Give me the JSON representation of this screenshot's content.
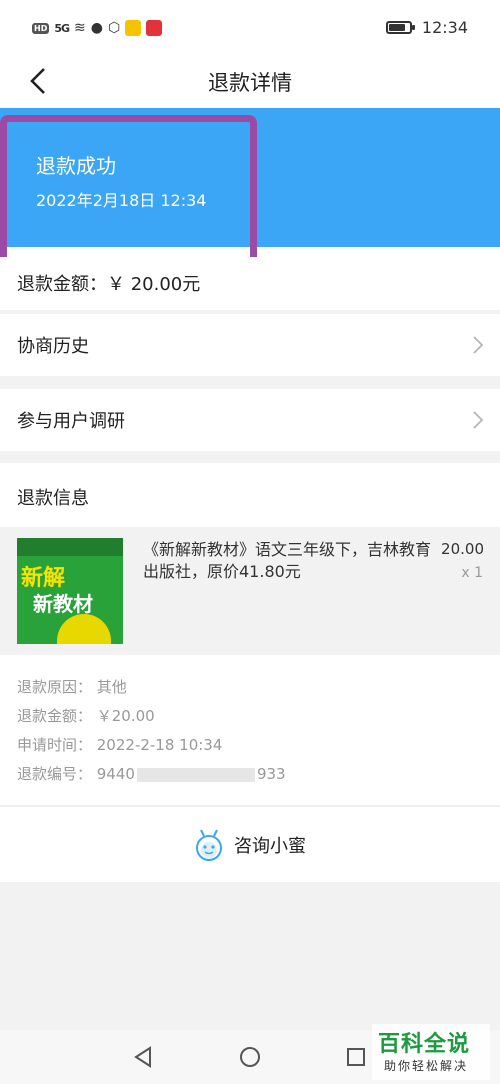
{
  "status_bar": {
    "hd": "HD",
    "signal": "5G",
    "time": "12:34",
    "battery_level": 0.75
  },
  "nav": {
    "title": "退款详情"
  },
  "banner": {
    "status": "退款成功",
    "time": "2022年2月18日 12:34",
    "color": "#3aa6f5",
    "highlight_color": "#9b4aa6"
  },
  "amount": {
    "label": "退款金额：￥ 20.00元"
  },
  "rows": {
    "history": "协商历史",
    "survey": "参与用户调研"
  },
  "section": {
    "refund_info": "退款信息"
  },
  "product": {
    "title": "《新解新教材》语文三年级下，吉林教育出版社，原价41.80元",
    "price": "20.00",
    "qty": "x 1",
    "cover_line1": "新解",
    "cover_line2": "新教材"
  },
  "details": {
    "reason": "退款原因：  其他",
    "amount": "退款金额：  ￥20.00",
    "apply_time": "申请时间：  2022-2-18 10:34",
    "refund_no_prefix": "退款编号：  9440",
    "refund_no_suffix": "933"
  },
  "consult": {
    "label": "咨询小蜜"
  },
  "watermark": {
    "big": "百科全说",
    "small": "助你轻松解决"
  }
}
